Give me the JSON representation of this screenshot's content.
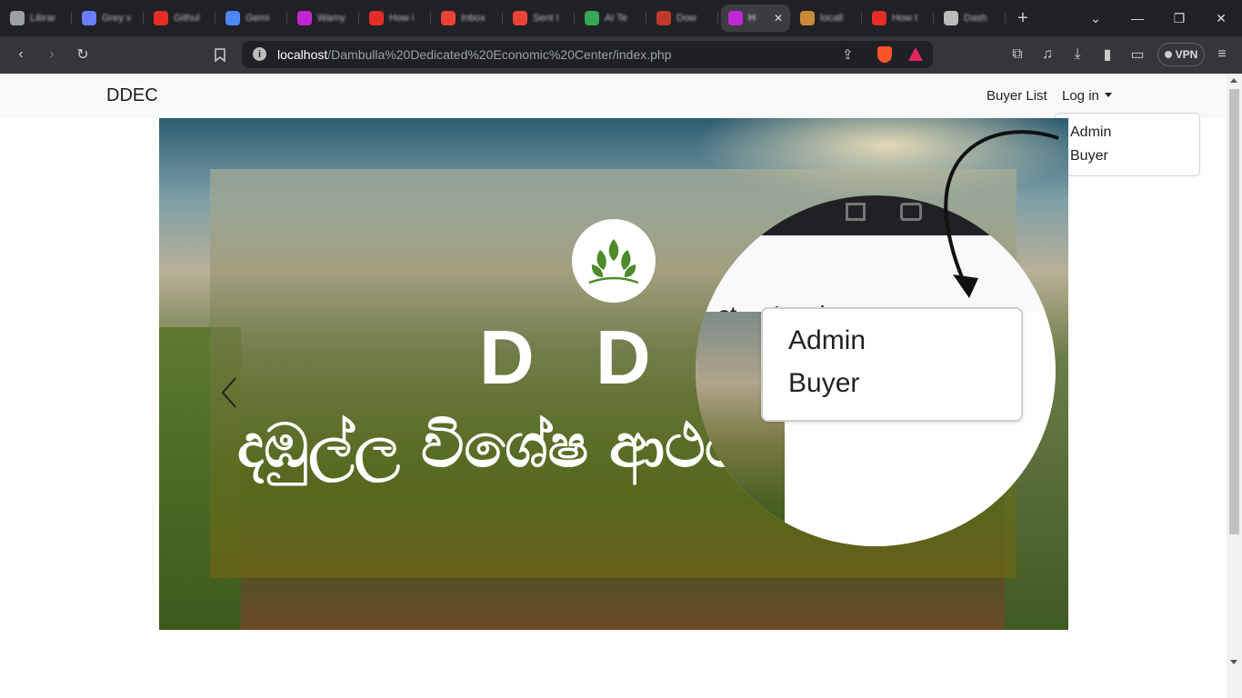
{
  "browser": {
    "tabs": [
      {
        "title": "Librar",
        "color": "#9aa0a6"
      },
      {
        "title": "Grey v",
        "color": "#6a7cff"
      },
      {
        "title": "Githul",
        "color": "#e52d27"
      },
      {
        "title": "Gemi",
        "color": "#4f86f7"
      },
      {
        "title": "Wamy",
        "color": "#c026d3"
      },
      {
        "title": "How i",
        "color": "#e52d27"
      },
      {
        "title": "Inbox",
        "color": "#ea4335"
      },
      {
        "title": "Sent I",
        "color": "#ea4335"
      },
      {
        "title": "AI Te",
        "color": "#34a853"
      },
      {
        "title": "Dow",
        "color": "#c0392b"
      },
      {
        "title": "H",
        "color": "#c026d3",
        "active": true
      },
      {
        "title": "locall",
        "color": "#c98a3a"
      },
      {
        "title": "How t",
        "color": "#e52d27"
      },
      {
        "title": "Dash",
        "color": "#bbbbbb"
      }
    ],
    "tab_close_glyph": "✕",
    "new_tab_glyph": "+",
    "url_host": "localhost",
    "url_path": "/Dambulla%20Dedicated%20Economic%20Center/index.php",
    "vpn_label": "VPN"
  },
  "navbar": {
    "brand": "DDEC",
    "buyer_list": "Buyer List",
    "login": "Log in",
    "dropdown": [
      "Admin",
      "Buyer"
    ]
  },
  "hero": {
    "logo_letters": "D D E",
    "sinhala": "දඹුල්ල විශේෂ ආර්ථික"
  },
  "zoom": {
    "partial_link": "st",
    "login": "Log in",
    "dropdown": [
      "Admin",
      "Buyer"
    ]
  }
}
